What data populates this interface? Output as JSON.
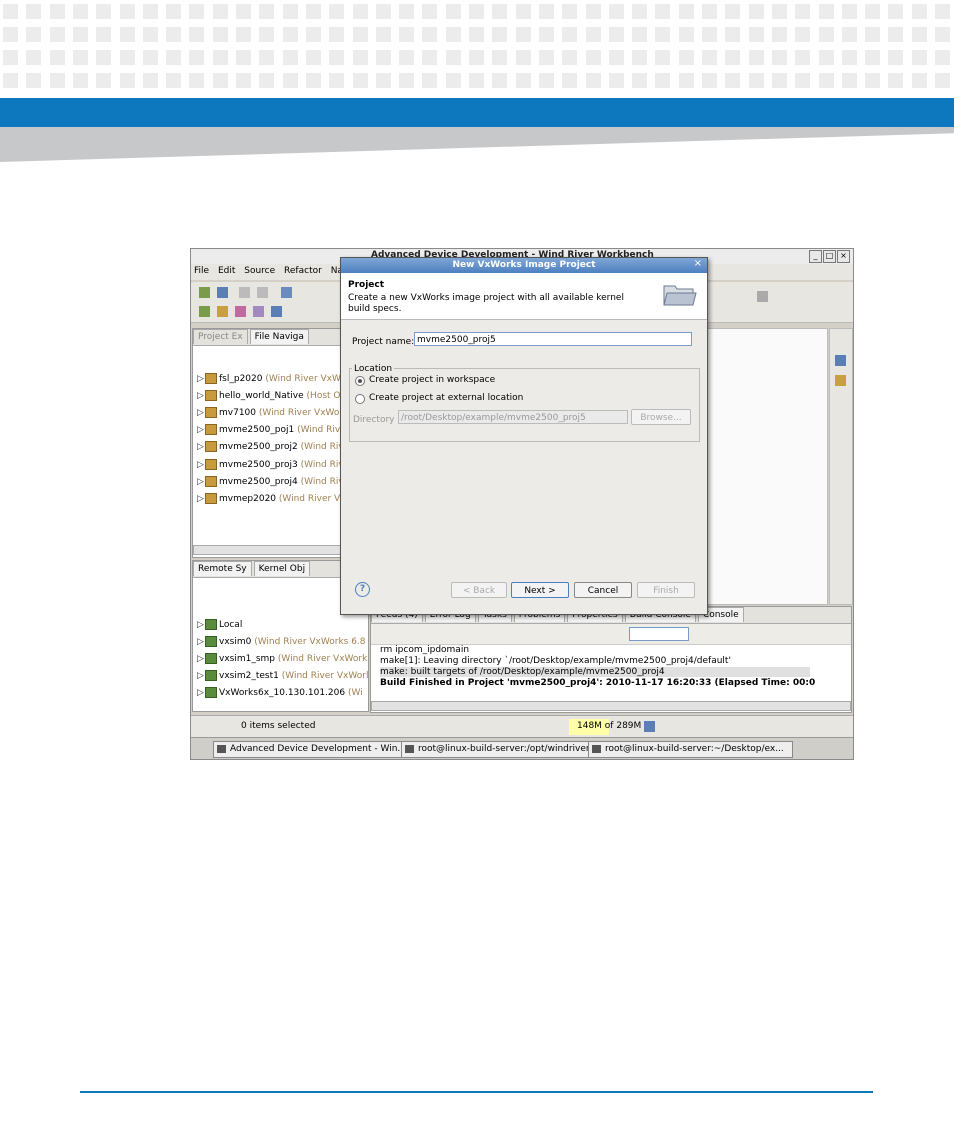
{
  "window": {
    "title": "Advanced Device Development - Wind River Workbench"
  },
  "menu": [
    "File",
    "Edit",
    "Source",
    "Refactor",
    "Navi"
  ],
  "project_explorer": {
    "tabs": [
      "Project Ex",
      "File Naviga"
    ],
    "items": [
      {
        "name": "fsl_p2020",
        "detail": "(Wind River VxWor"
      },
      {
        "name": "hello_world_Native",
        "detail": "(Host OS ("
      },
      {
        "name": "mv7100",
        "detail": "(Wind River VxWorks"
      },
      {
        "name": "mvme2500_poj1",
        "detail": "(Wind River"
      },
      {
        "name": "mvme2500_proj2",
        "detail": "(Wind River"
      },
      {
        "name": "mvme2500_proj3",
        "detail": "(Wind River"
      },
      {
        "name": "mvme2500_proj4",
        "detail": "(Wind River"
      },
      {
        "name": "mvmep2020",
        "detail": "(Wind River VxV"
      }
    ]
  },
  "remote_systems": {
    "tabs": [
      "Remote Sy",
      "Kernel Obj"
    ],
    "items": [
      {
        "name": "Local",
        "detail": ""
      },
      {
        "name": "vxsim0",
        "detail": "(Wind River VxWorks 6.8"
      },
      {
        "name": "vxsim1_smp",
        "detail": "(Wind River VxWork"
      },
      {
        "name": "vxsim2_test1",
        "detail": "(Wind River VxWorl"
      },
      {
        "name": "VxWorks6x_10.130.101.206",
        "detail": "(Wi"
      }
    ]
  },
  "console": {
    "tabs": [
      "Feeds (4)",
      "Error Log",
      "Tasks",
      "Problems",
      "Properties",
      "Build Console",
      "Console"
    ],
    "lines": [
      "rm ipcom_ipdomain",
      "make[1]: Leaving directory `/root/Desktop/example/mvme2500_proj4/default'",
      "make: built targets of /root/Desktop/example/mvme2500_proj4",
      "Build Finished in Project 'mvme2500_proj4':   2010-11-17 16:20:33   (Elapsed Time: 00:0"
    ]
  },
  "status": {
    "selection": "0 items selected",
    "memory": "148M of 289M"
  },
  "taskbar": [
    "Advanced Device Development - Win...",
    "root@linux-build-server:/opt/windriver...",
    "root@linux-build-server:~/Desktop/ex..."
  ],
  "dialog": {
    "title": "New VxWorks Image Project",
    "heading": "Project",
    "description": "Create a new VxWorks image project with all available kernel build specs.",
    "project_name_label": "Project name:",
    "project_name_value": "mvme2500_proj5",
    "location_label": "Location",
    "radio_workspace": "Create project in workspace",
    "radio_external": "Create project at external location",
    "directory_label": "Directory",
    "directory_value": "/root/Desktop/example/mvme2500_proj5",
    "browse": "Browse...",
    "back": "< Back",
    "next": "Next >",
    "cancel": "Cancel",
    "finish": "Finish"
  }
}
